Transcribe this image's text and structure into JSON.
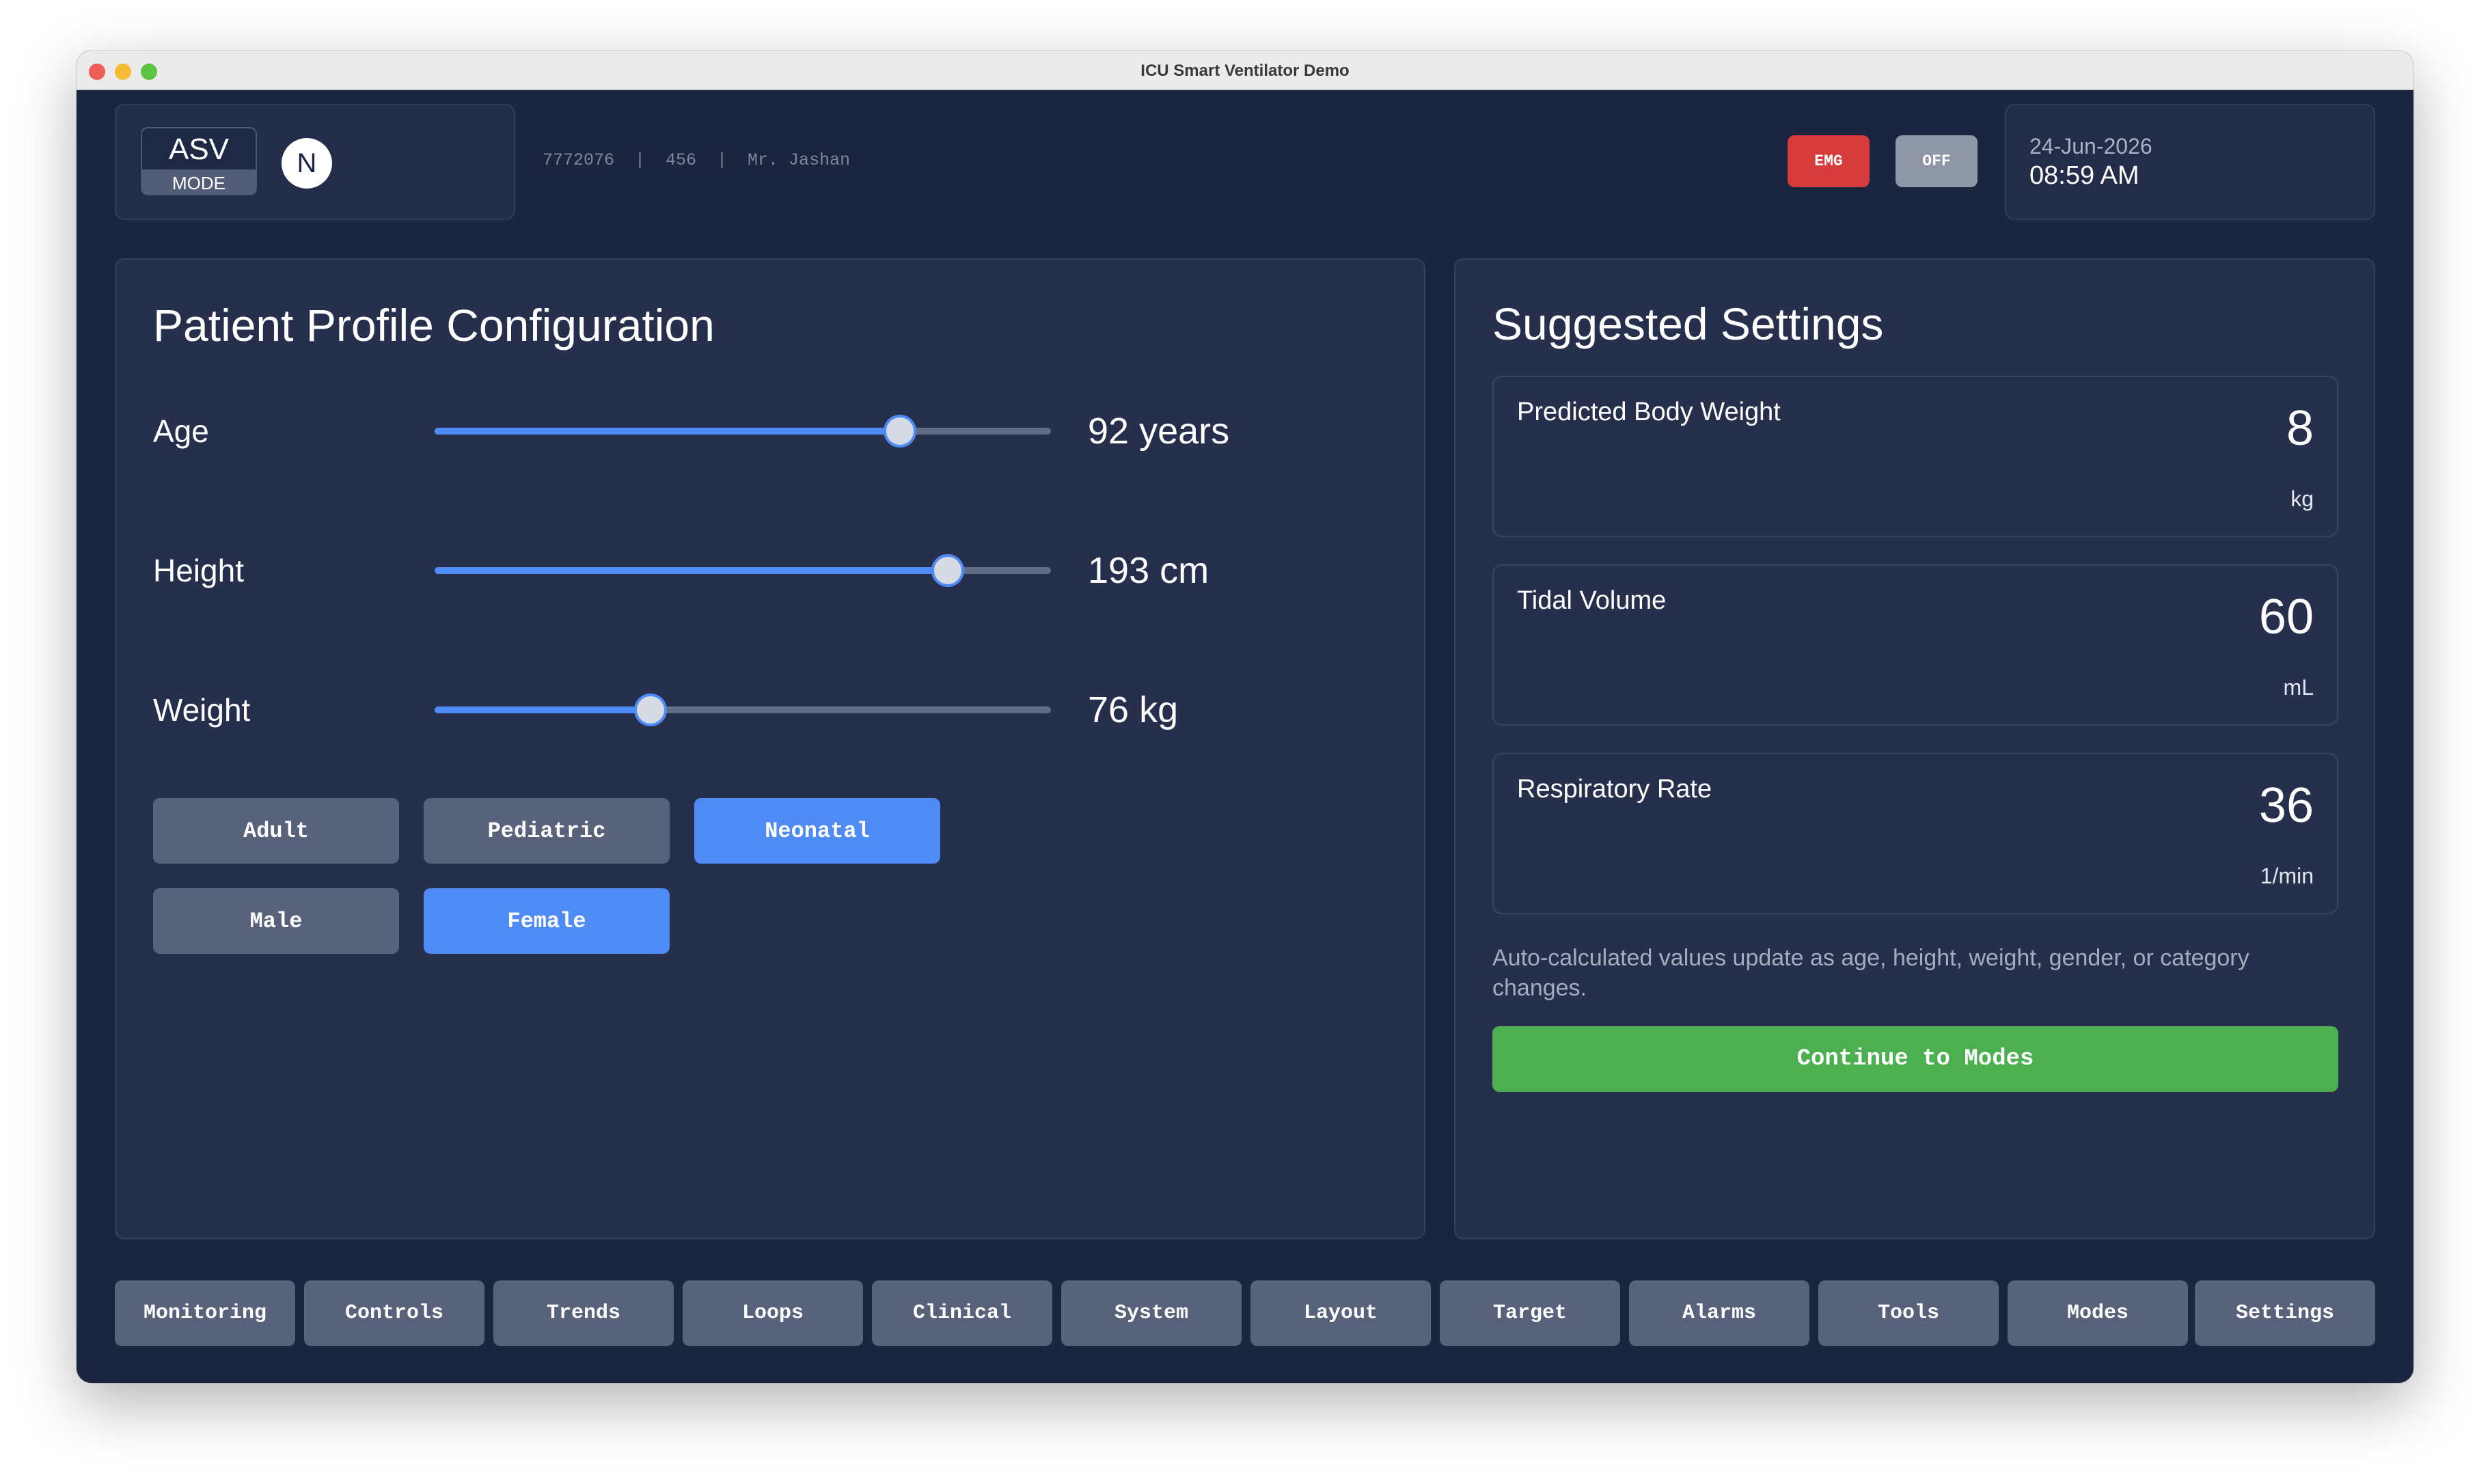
{
  "window": {
    "title": "ICU Smart Ventilator Demo"
  },
  "header": {
    "mode_name": "ASV",
    "mode_sub": "MODE",
    "avatar_letter": "N",
    "patient_info": "7772076  |  456  |  Mr. Jashan",
    "emg_label": "EMG",
    "off_label": "OFF",
    "date": "24-Jun-2026",
    "time": "08:59 AM"
  },
  "profile": {
    "title": "Patient Profile Configuration",
    "sliders": [
      {
        "label": "Age",
        "value_text": "92 years",
        "fill_fraction": 0.755
      },
      {
        "label": "Height",
        "value_text": "193 cm",
        "fill_fraction": 0.833
      },
      {
        "label": "Weight",
        "value_text": "76 kg",
        "fill_fraction": 0.35
      }
    ],
    "categories": [
      "Adult",
      "Pediatric",
      "Neonatal"
    ],
    "selected_category": "Neonatal",
    "genders": [
      "Male",
      "Female"
    ],
    "selected_gender": "Female"
  },
  "suggested": {
    "title": "Suggested Settings",
    "metrics": [
      {
        "label": "Predicted Body Weight",
        "value": "8",
        "unit": "kg"
      },
      {
        "label": "Tidal Volume",
        "value": "60",
        "unit": "mL"
      },
      {
        "label": "Respiratory Rate",
        "value": "36",
        "unit": "1/min"
      }
    ],
    "note": "Auto-calculated values update as age, height, weight, gender, or category changes.",
    "continue_label": "Continue to Modes"
  },
  "nav": [
    "Monitoring",
    "Controls",
    "Trends",
    "Loops",
    "Clinical",
    "System",
    "Layout",
    "Target",
    "Alarms",
    "Tools",
    "Modes",
    "Settings"
  ],
  "colors": {
    "background": "#1c2540",
    "panel": "#26304d",
    "accent_blue": "#4f8bf4",
    "button_gray": "#58627b",
    "emergency_red": "#d63b3b",
    "off_gray": "#8f96a5",
    "continue_green": "#4caf50"
  }
}
